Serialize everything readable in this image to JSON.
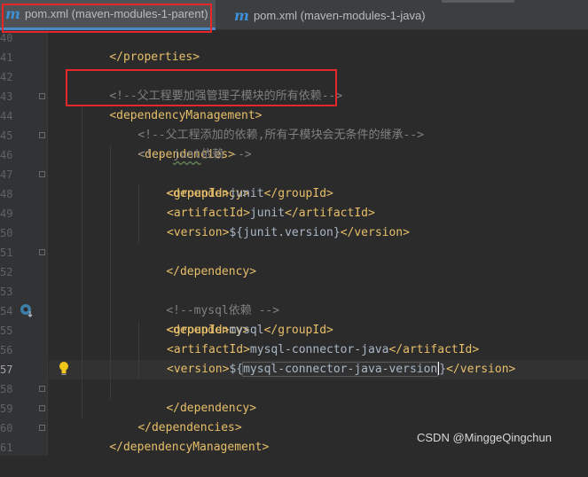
{
  "tabs": [
    {
      "icon": "m",
      "label": "pom.xml (maven-modules-1-parent)"
    },
    {
      "icon": "m",
      "label": "pom.xml (maven-modules-1-java)"
    }
  ],
  "line_numbers": [
    "40",
    "41",
    "42",
    "43",
    "44",
    "45",
    "46",
    "47",
    "48",
    "49",
    "50",
    "51",
    "52",
    "53",
    "54",
    "55",
    "56",
    "57",
    "58",
    "59",
    "60",
    "61"
  ],
  "code": {
    "l40": {
      "close_tag": "</properties>"
    },
    "l42": {
      "comment": "<!--父工程要加强管理子模块的所有依赖-->"
    },
    "l43": {
      "tag": "<dependencyManagement>"
    },
    "l44": {
      "comment": "<!--父工程添加的依赖,所有子模块会无条件的继承-->"
    },
    "l45": {
      "tag": "<dependencies>"
    },
    "l46": {
      "comment_start": "<!-- ",
      "comment_word": "junt",
      "comment_end": "依赖 -->"
    },
    "l47": {
      "tag": "<dependency>"
    },
    "l48": {
      "open": "<groupId>",
      "value": "junit",
      "close": "</groupId>"
    },
    "l49": {
      "open": "<artifactId>",
      "value": "junit",
      "close": "</artifactId>"
    },
    "l50": {
      "open": "<version>",
      "value": "${junit.version}",
      "close": "</version>"
    },
    "l51": {
      "tag": "</dependency>"
    },
    "l53": {
      "comment": "<!--mysql依赖 -->"
    },
    "l54": {
      "tag": "<dependency>"
    },
    "l55": {
      "open": "<groupId>",
      "value": "mysql",
      "close": "</groupId>"
    },
    "l56": {
      "open": "<artifactId>",
      "value": "mysql-connector-java",
      "close": "</artifactId>"
    },
    "l57": {
      "open": "<version>",
      "value_start": "${",
      "value_mid": "mysql-connector-java-version",
      "value_end": "}",
      "close": "</version>"
    },
    "l58": {
      "tag": "</dependency>"
    },
    "l59": {
      "tag": "</dependencies>"
    },
    "l60": {
      "tag": "</dependencyManagement>"
    }
  },
  "watermark": "CSDN @MinggeQingchun",
  "icons": {
    "tab": "maven-m-icon",
    "run": "run-gutter-icon",
    "bulb": "intention-bulb-icon"
  },
  "colors": {
    "tag": "#e8bf6a",
    "comment": "#808080",
    "text": "#a9b7c6",
    "highlight_box": "#e8272a"
  }
}
